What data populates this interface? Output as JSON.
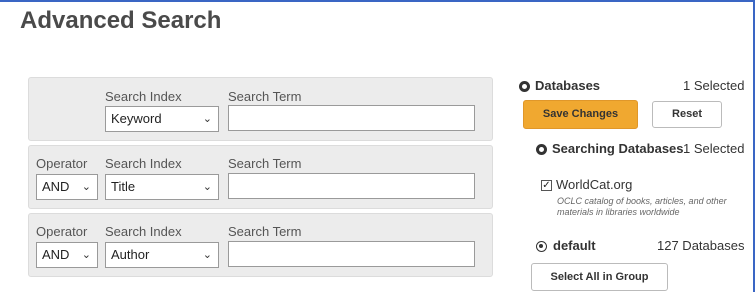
{
  "page": {
    "title": "Advanced Search"
  },
  "search_rows": [
    {
      "search_index_label": "Search Index",
      "search_term_label": "Search Term",
      "index_value": "Keyword",
      "term_value": ""
    },
    {
      "operator_label": "Operator",
      "operator_value": "AND",
      "search_index_label": "Search Index",
      "search_term_label": "Search Term",
      "index_value": "Title",
      "term_value": ""
    },
    {
      "operator_label": "Operator",
      "operator_value": "AND",
      "search_index_label": "Search Index",
      "search_term_label": "Search Term",
      "index_value": "Author",
      "term_value": ""
    }
  ],
  "databases": {
    "label": "Databases",
    "selected_count": "1 Selected",
    "save_label": "Save Changes",
    "reset_label": "Reset",
    "searching_label": "Searching Databases",
    "searching_count": "1 Selected",
    "items": [
      {
        "name": "WorldCat.org",
        "checked": true,
        "description": "OCLC catalog of books, articles, and other materials in libraries worldwide"
      }
    ],
    "group_label": "default",
    "group_count": "127 Databases",
    "select_all_label": "Select All in Group"
  },
  "icons": {
    "select_chevron": "chevron-down-icon",
    "section_toggle": "circle-chevron-icon"
  },
  "colors": {
    "accent_button": "#f0a830",
    "frame_border": "#3a66c4",
    "row_background": "#ececec"
  }
}
